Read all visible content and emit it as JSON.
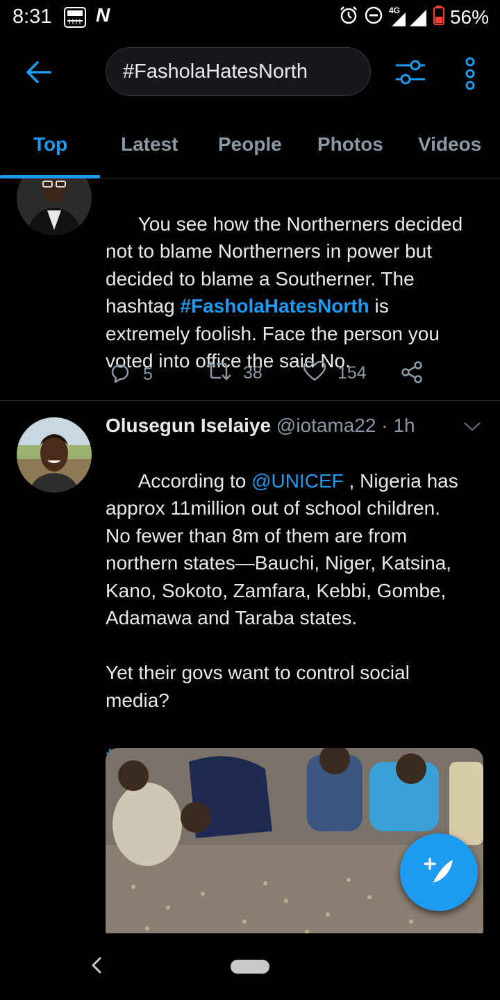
{
  "status_bar": {
    "time": "8:31",
    "network": "4G",
    "battery": "56%"
  },
  "header": {
    "search_query": "#FasholaHatesNorth"
  },
  "tabs": [
    {
      "label": "Top",
      "active": true
    },
    {
      "label": "Latest",
      "active": false
    },
    {
      "label": "People",
      "active": false
    },
    {
      "label": "Photos",
      "active": false
    },
    {
      "label": "Videos",
      "active": false
    }
  ],
  "tweets": [
    {
      "text_parts": [
        {
          "t": "You see how the Northerners decided\nnot to blame Northerners in power but\ndecided to blame a Southerner. The\nhashtag "
        },
        {
          "t": "#FasholaHatesNorth",
          "type": "hashtag"
        },
        {
          "t": " is\nextremely foolish. Face the person you\nvoted into office the said No."
        }
      ],
      "replies": "5",
      "retweets": "38",
      "likes": "154"
    },
    {
      "name": "Olusegun Iselaiye",
      "handle": "@iotama22",
      "time": " · 1h",
      "text_parts": [
        {
          "t": "According to "
        },
        {
          "t": "@UNICEF",
          "type": "mention"
        },
        {
          "t": " , Nigeria has\napprox 11million out of school children.\nNo fewer than 8m of them are from\nnorthern states—Bauchi, Niger, Katsina,\nKano, Sokoto, Zamfara, Kebbi, Gombe,\nAdamawa and Taraba states.\n\nYet their govs want to control social\nmedia?\n\n"
        },
        {
          "t": "#FasholaHatesNorth",
          "type": "hashtag"
        }
      ]
    }
  ],
  "colors": {
    "accent": "#1d9bf0",
    "background": "#000000",
    "secondary_text": "#8b98a5"
  }
}
